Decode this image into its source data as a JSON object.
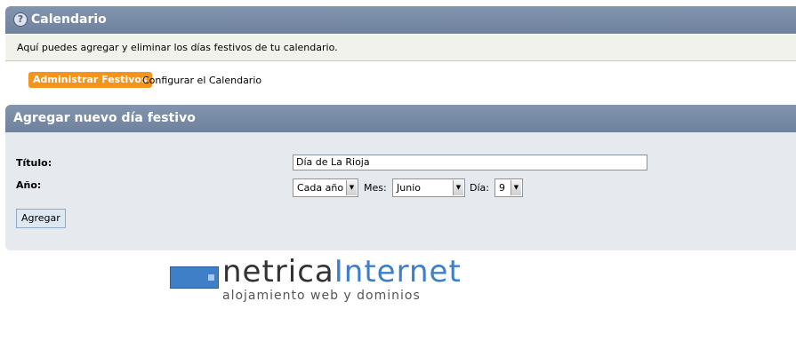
{
  "header": {
    "help_icon": "?",
    "title": "Calendario"
  },
  "info": {
    "text": "Aquí puedes agregar y eliminar los días festivos de tu calendario."
  },
  "tabs": {
    "active": "Administrar Festivos",
    "other": "Configurar el Calendario"
  },
  "section": {
    "title": "Agregar nuevo día festivo"
  },
  "form": {
    "title_label": "Título:",
    "title_value": "Día de La Rioja",
    "year_label": "Año:",
    "year_value": "Cada año",
    "month_label": "Mes:",
    "month_value": "Junio",
    "day_label": "Día:",
    "day_value": "9",
    "submit_label": "Agregar"
  },
  "logo": {
    "word_dark": "netrica",
    "word_accent": "Internet",
    "tagline": "alojamiento web y dominios"
  },
  "colors": {
    "header_bar": "#7b8ea8",
    "accent_orange": "#f5941d",
    "logo_blue": "#3f7fc8"
  },
  "icons": {
    "select_arrow": "▼"
  }
}
